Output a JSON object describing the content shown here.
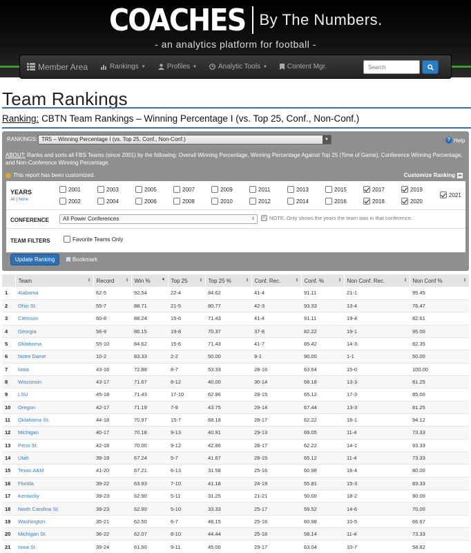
{
  "header": {
    "logo_main": "COACHES",
    "logo_sub": "By The Numbers.",
    "tagline": "- an analytics platform for football -"
  },
  "nav": {
    "brand": "Member Area",
    "items": [
      "Rankings",
      "Profiles",
      "Analytic Tools",
      "Content Mgr."
    ],
    "search_placeholder": "Search"
  },
  "page": {
    "title": "Team Rankings",
    "ranking_label": "Ranking:",
    "ranking_name": "CBTN Team Rankings – Winning Percentage I (vs. Top 25, Conf., Non-Conf.)"
  },
  "panel": {
    "rankings_label": "RANKINGS:",
    "rankings_selected": "TR5 – Winning Percentage I (vs. Top 25, Conf., Non-Conf.)",
    "help": "Help",
    "about_label": "ABOUT:",
    "about_text": "Ranks and sorts all FBS Teams (since 2001) by the following: Overall Winning Percentage, Winning Percentage Against Top 25 (Time of Game), Conference Winning Percentage, and Non-Conference Winning Percentage.",
    "customized_msg": "This report has been customized.",
    "customize_label": "Customize Ranking",
    "years_title": "YEARS",
    "years_all": "All",
    "years_sep": "|",
    "years_none": "None",
    "years": [
      {
        "label": "2001",
        "checked": false
      },
      {
        "label": "2002",
        "checked": false
      },
      {
        "label": "2003",
        "checked": false
      },
      {
        "label": "2004",
        "checked": false
      },
      {
        "label": "2005",
        "checked": false
      },
      {
        "label": "2006",
        "checked": false
      },
      {
        "label": "2007",
        "checked": false
      },
      {
        "label": "2008",
        "checked": false
      },
      {
        "label": "2009",
        "checked": false
      },
      {
        "label": "2010",
        "checked": false
      },
      {
        "label": "2011",
        "checked": false
      },
      {
        "label": "2012",
        "checked": false
      },
      {
        "label": "2013",
        "checked": false
      },
      {
        "label": "2014",
        "checked": false
      },
      {
        "label": "2015",
        "checked": false
      },
      {
        "label": "2016",
        "checked": false
      },
      {
        "label": "2017",
        "checked": true
      },
      {
        "label": "2018",
        "checked": true
      },
      {
        "label": "2019",
        "checked": true
      },
      {
        "label": "2020",
        "checked": true
      },
      {
        "label": "2021",
        "checked": true
      }
    ],
    "conference_title": "CONFERENCE",
    "conference_selected": "All Power Conferences",
    "conference_note": "NOTE: Only shows the years the team was in that conference.",
    "team_filters_title": "TEAM FILTERS",
    "favorite_label": "Favorite Teams Only",
    "update_button": "Update Ranking",
    "bookmark": "Bookmark"
  },
  "table": {
    "columns": [
      "",
      "Team",
      "Record",
      "Win %",
      "Top 25",
      "Top 25 %",
      "Conf. Rec.",
      "Conf. %",
      "Non Conf. Rec.",
      "Non Conf %"
    ],
    "rows": [
      [
        "1",
        "Alabama",
        "62-5",
        "92.54",
        "22-4",
        "84.62",
        "41-4",
        "91.11",
        "21-1",
        "95.45"
      ],
      [
        "2",
        "Ohio St.",
        "55-7",
        "88.71",
        "21-5",
        "80.77",
        "42-3",
        "93.33",
        "13-4",
        "76.47"
      ],
      [
        "3",
        "Clemson",
        "60-8",
        "88.24",
        "15-6",
        "71.43",
        "41-4",
        "91.11",
        "19-4",
        "82.61"
      ],
      [
        "4",
        "Georgia",
        "56-9",
        "86.15",
        "19-8",
        "70.37",
        "37-8",
        "82.22",
        "19-1",
        "95.00"
      ],
      [
        "5",
        "Oklahoma",
        "55-10",
        "84.62",
        "15-6",
        "71.43",
        "41-7",
        "85.42",
        "14-3",
        "82.35"
      ],
      [
        "6",
        "Notre Dame",
        "10-2",
        "83.33",
        "2-2",
        "50.00",
        "9-1",
        "90.00",
        "1-1",
        "50.00"
      ],
      [
        "7",
        "Iowa",
        "43-16",
        "72.88",
        "8-7",
        "53.33",
        "28-16",
        "63.64",
        "15-0",
        "100.00"
      ],
      [
        "8",
        "Wisconsin",
        "43-17",
        "71.67",
        "8-12",
        "40.00",
        "30-14",
        "68.18",
        "13-3",
        "81.25"
      ],
      [
        "9",
        "LSU",
        "45-18",
        "71.43",
        "17-10",
        "62.96",
        "28-15",
        "65.12",
        "17-3",
        "85.00"
      ],
      [
        "10",
        "Oregon",
        "42-17",
        "71.19",
        "7-9",
        "43.75",
        "29-14",
        "67.44",
        "13-3",
        "81.25"
      ],
      [
        "11",
        "Oklahoma St.",
        "44-18",
        "70.97",
        "15-7",
        "68.18",
        "28-17",
        "62.22",
        "16-1",
        "94.12"
      ],
      [
        "12",
        "Michigan",
        "40-17",
        "70.18",
        "9-13",
        "40.91",
        "29-13",
        "69.05",
        "11-4",
        "73.33"
      ],
      [
        "13",
        "Penn St.",
        "42-18",
        "70.00",
        "9-12",
        "42.86",
        "28-17",
        "62.22",
        "14-1",
        "93.33"
      ],
      [
        "14",
        "Utah",
        "39-19",
        "67.24",
        "5-7",
        "41.67",
        "28-15",
        "65.12",
        "11-4",
        "73.33"
      ],
      [
        "15",
        "Texas A&M",
        "41-20",
        "67.21",
        "6-13",
        "31.58",
        "25-16",
        "60.98",
        "16-4",
        "80.00"
      ],
      [
        "16",
        "Florida",
        "39-22",
        "63.93",
        "7-10",
        "41.18",
        "24-19",
        "55.81",
        "15-3",
        "83.33"
      ],
      [
        "17",
        "Kentucky",
        "39-23",
        "62.90",
        "5-11",
        "31.25",
        "21-21",
        "50.00",
        "18-2",
        "90.00"
      ],
      [
        "18",
        "North Carolina St.",
        "39-23",
        "62.90",
        "5-10",
        "33.33",
        "25-17",
        "59.52",
        "14-6",
        "70.00"
      ],
      [
        "19",
        "Washington",
        "35-21",
        "62.50",
        "6-7",
        "46.15",
        "25-16",
        "60.98",
        "10-5",
        "66.67"
      ],
      [
        "20",
        "Michigan St.",
        "36-22",
        "62.07",
        "8-10",
        "44.44",
        "25-18",
        "58.14",
        "11-4",
        "73.33"
      ],
      [
        "21",
        "Iowa St.",
        "39-24",
        "61.90",
        "9-11",
        "45.00",
        "29-17",
        "63.04",
        "10-7",
        "58.82"
      ]
    ]
  }
}
